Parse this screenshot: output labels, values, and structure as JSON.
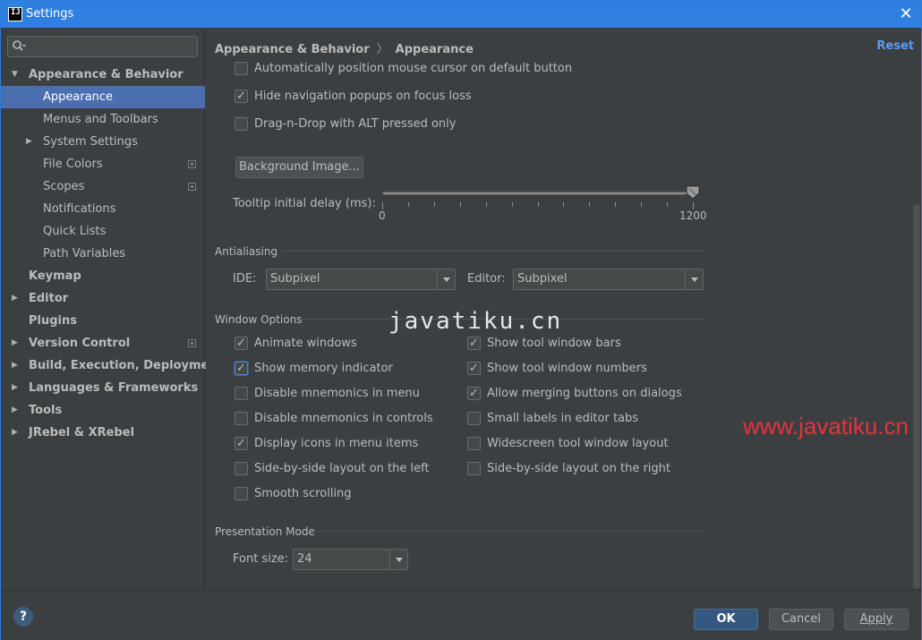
{
  "window": {
    "title": "Settings",
    "app_icon_text": "IJ"
  },
  "search": {
    "placeholder": "",
    "value": ""
  },
  "sidebar": {
    "items": [
      {
        "label": "Appearance & Behavior",
        "level": 0,
        "arrow": "down",
        "bold": true
      },
      {
        "label": "Appearance",
        "level": 1,
        "selected": true
      },
      {
        "label": "Menus and Toolbars",
        "level": 1
      },
      {
        "label": "System Settings",
        "level": 1,
        "arrow": "right"
      },
      {
        "label": "File Colors",
        "level": 1,
        "project_icon": true
      },
      {
        "label": "Scopes",
        "level": 1,
        "project_icon": true
      },
      {
        "label": "Notifications",
        "level": 1
      },
      {
        "label": "Quick Lists",
        "level": 1
      },
      {
        "label": "Path Variables",
        "level": 1
      },
      {
        "label": "Keymap",
        "level": 0,
        "bold": true
      },
      {
        "label": "Editor",
        "level": 0,
        "arrow": "right",
        "bold": true
      },
      {
        "label": "Plugins",
        "level": 0,
        "bold": true
      },
      {
        "label": "Version Control",
        "level": 0,
        "arrow": "right",
        "bold": true,
        "project_icon": true
      },
      {
        "label": "Build, Execution, Deployment",
        "level": 0,
        "arrow": "right",
        "bold": true
      },
      {
        "label": "Languages & Frameworks",
        "level": 0,
        "arrow": "right",
        "bold": true
      },
      {
        "label": "Tools",
        "level": 0,
        "arrow": "right",
        "bold": true
      },
      {
        "label": "JRebel & XRebel",
        "level": 0,
        "arrow": "right",
        "bold": true
      }
    ]
  },
  "header": {
    "crumb_parent": "Appearance & Behavior",
    "crumb_sep": "〉",
    "crumb_current": "Appearance",
    "reset_label": "Reset"
  },
  "top_options": [
    {
      "label": "Automatically position mouse cursor on default button",
      "checked": false
    },
    {
      "label": "Hide navigation popups on focus loss",
      "checked": true
    },
    {
      "label": "Drag-n-Drop with ALT pressed only",
      "checked": false
    }
  ],
  "background_button": {
    "label": "Background Image..."
  },
  "tooltip": {
    "label": "Tooltip initial delay (ms):",
    "min_label": "0",
    "max_label": "1200",
    "value": 1200
  },
  "antialiasing": {
    "title": "Antialiasing",
    "ide_label": "IDE:",
    "ide_value": "Subpixel",
    "editor_label": "Editor:",
    "editor_value": "Subpixel"
  },
  "window_options": {
    "title": "Window Options",
    "left": [
      {
        "label": "Animate windows",
        "checked": true
      },
      {
        "label": "Show memory indicator",
        "checked": true,
        "focused": true
      },
      {
        "label": "Disable mnemonics in menu",
        "checked": false
      },
      {
        "label": "Disable mnemonics in controls",
        "checked": false
      },
      {
        "label": "Display icons in menu items",
        "checked": true
      },
      {
        "label": "Side-by-side layout on the left",
        "checked": false
      },
      {
        "label": "Smooth scrolling",
        "checked": false
      }
    ],
    "right": [
      {
        "label": "Show tool window bars",
        "checked": true
      },
      {
        "label": "Show tool window numbers",
        "checked": true
      },
      {
        "label": "Allow merging buttons on dialogs",
        "checked": true
      },
      {
        "label": "Small labels in editor tabs",
        "checked": false
      },
      {
        "label": "Widescreen tool window layout",
        "checked": false
      },
      {
        "label": "Side-by-side layout on the right",
        "checked": false
      }
    ]
  },
  "presentation": {
    "title": "Presentation Mode",
    "font_label": "Font size:",
    "font_value": "24"
  },
  "footer": {
    "help_glyph": "?",
    "ok_label": "OK",
    "cancel_label": "Cancel",
    "apply_label": "Apply"
  },
  "watermarks": {
    "center": "javatiku.cn",
    "right": "www.javatiku.cn"
  },
  "colors": {
    "titlebar": "#2f80e0",
    "selection": "#4b6eaf",
    "link": "#589df6",
    "watermark_red": "#e8333a"
  }
}
